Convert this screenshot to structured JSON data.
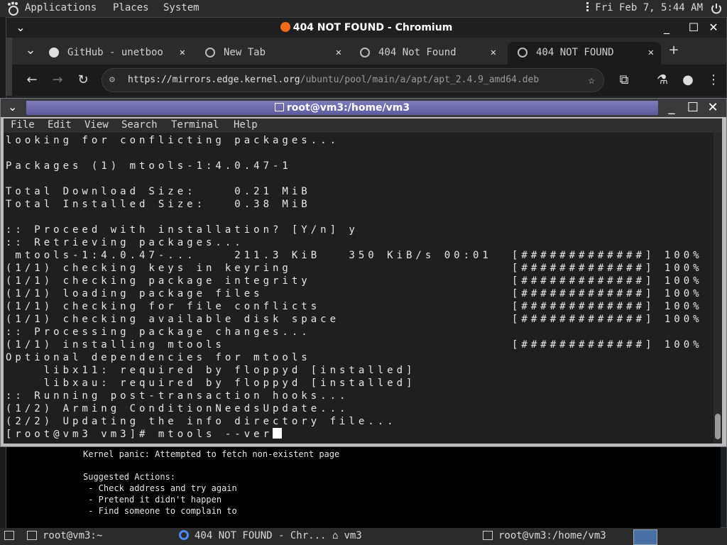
{
  "top_panel": {
    "menus": [
      "Applications",
      "Places",
      "System"
    ],
    "clock": "Fri Feb  7,  5:44 AM"
  },
  "browser": {
    "window_title": "404 NOT FOUND - Chromium",
    "tabs": [
      {
        "label": "GitHub - unetboo"
      },
      {
        "label": "New Tab"
      },
      {
        "label": "404 Not Found"
      },
      {
        "label": "404 NOT FOUND"
      }
    ],
    "new_tab": "+",
    "url_domain": "https://mirrors.edge.kernel.org",
    "url_path": "/ubuntu/pool/main/a/apt/apt_2.4.9_amd64.deb",
    "page": {
      "line1": "Kernel panic: Attempted to fetch non-existent page",
      "line2": "Suggested Actions:",
      "line3": " - Check address and try again",
      "line4": " - Pretend it didn't happen",
      "line5": " - Find someone to complain to"
    }
  },
  "terminal": {
    "title": "root@vm3:/home/vm3",
    "menu": [
      "File",
      "Edit",
      "View",
      "Search",
      "Terminal",
      "Help"
    ],
    "lines": [
      "looking for conflicting packages...",
      "",
      "Packages (1) mtools-1:4.0.47-1",
      "",
      "Total Download Size:    0.21 MiB",
      "Total Installed Size:   0.38 MiB",
      "",
      ":: Proceed with installation? [Y/n] y",
      ":: Retrieving packages...",
      " mtools-1:4.0.47-...    211.3 KiB   350 KiB/s 00:01",
      "(1/1) checking keys in keyring",
      "(1/1) checking package integrity",
      "(1/1) loading package files",
      "(1/1) checking for file conflicts",
      "(1/1) checking available disk space",
      ":: Processing package changes...",
      "(1/1) installing mtools",
      "Optional dependencies for mtools",
      "    libx11: required by floppyd [installed]",
      "    libxau: required by floppyd [installed]",
      ":: Running post-transaction hooks...",
      "(1/2) Arming ConditionNeedsUpdate...",
      "(2/2) Updating the info directory file...",
      "[root@vm3 vm3]# mtools --ver"
    ],
    "progress": "[#############] 100%"
  },
  "taskbar": {
    "items": [
      "root@vm3:~",
      "404 NOT FOUND - Chr...",
      "vm3",
      "root@vm3:/home/vm3"
    ]
  }
}
